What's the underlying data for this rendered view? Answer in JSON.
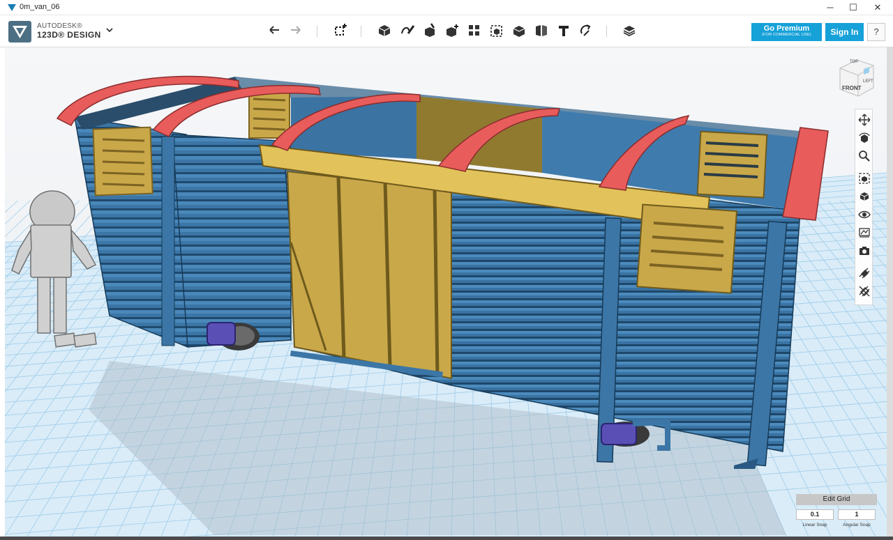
{
  "window": {
    "title": "0m_van_06",
    "minimize_glyph": "─",
    "maximize_glyph": "☐",
    "close_glyph": "✕"
  },
  "app": {
    "brand_line1": "AUTODESK®",
    "brand_line2": "123D® DESIGN",
    "menu_icon": "chevron-down-icon",
    "accent_color": "#16a1d8"
  },
  "toolbar": {
    "icons": [
      "undo-icon",
      "redo-icon",
      "transform-icon",
      "primitives-icon",
      "sketch-icon",
      "construct-icon",
      "modify-icon",
      "pattern-icon",
      "grouping-icon",
      "combine-icon",
      "measure-icon",
      "text-icon",
      "snap-icon",
      "material-icon"
    ],
    "premium_label": "Go Premium",
    "premium_sublabel": "(FOR COMMERCIAL USE)",
    "signin_label": "Sign In",
    "help_label": "?"
  },
  "viewcube": {
    "front_label": "FRONT",
    "top_label": "TOP",
    "left_label": "LEFT"
  },
  "navbar": {
    "icons": [
      "pan-icon",
      "orbit-icon",
      "zoom-icon",
      "fit-icon",
      "view-mode-icon",
      "visibility-icon",
      "materials-icon",
      "screenshot-icon",
      "show-grid-icon",
      "hide-grid-icon"
    ]
  },
  "grid": {
    "edit_label": "Edit Grid",
    "linear_snap_value": "0.1",
    "angular_snap_value": "1",
    "linear_snap_label": "Linear Snap",
    "angular_snap_label": "Angular Snap"
  },
  "colors": {
    "body_blue": "#3c76a6",
    "door_mustard": "#c9a84a",
    "roof_red": "#e85c5c",
    "bogie_purple": "#5a4fb5",
    "grid_blue": "#8fc3e6"
  }
}
